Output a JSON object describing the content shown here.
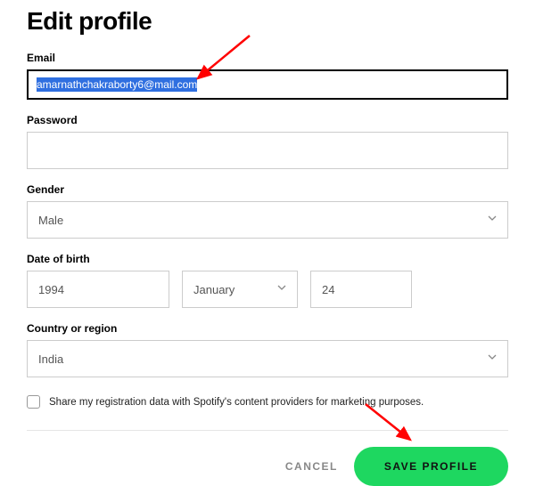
{
  "title": "Edit profile",
  "labels": {
    "email": "Email",
    "password": "Password",
    "gender": "Gender",
    "dob": "Date of birth",
    "country": "Country or region"
  },
  "values": {
    "email": "amarnathchakraborty6@mail.com",
    "password": "",
    "gender": "Male",
    "dob_year": "1994",
    "dob_month": "January",
    "dob_day": "24",
    "country": "India"
  },
  "checkbox": {
    "checked": false,
    "label": "Share my registration data with Spotify's content providers for marketing purposes."
  },
  "buttons": {
    "cancel": "CANCEL",
    "save": "SAVE PROFILE"
  },
  "colors": {
    "accent": "#1ed760",
    "selection": "#2f6fe0",
    "annotation": "#ff0000"
  }
}
